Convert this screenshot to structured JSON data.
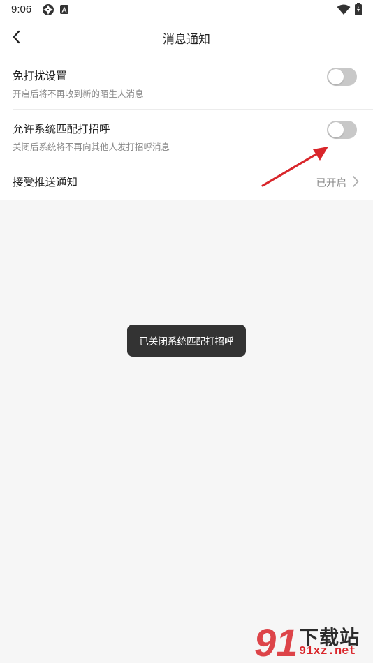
{
  "status_bar": {
    "time": "9:06",
    "icons": [
      "aperture-icon",
      "a-letter-icon",
      "wifi-icon",
      "battery-charging-icon"
    ]
  },
  "header": {
    "title": "消息通知",
    "back_icon": "chevron-left-icon"
  },
  "settings": [
    {
      "title": "免打扰设置",
      "subtitle": "开启后将不再收到新的陌生人消息",
      "toggle_on": false
    },
    {
      "title": "允许系统匹配打招呼",
      "subtitle": "关闭后系统将不再向其他人发打招呼消息",
      "toggle_on": false
    },
    {
      "title": "接受推送通知",
      "value": "已开启",
      "icon": "chevron-right-icon"
    }
  ],
  "toast": {
    "text": "已关闭系统匹配打招呼"
  },
  "colors": {
    "toggle_off": "#c8c8c8",
    "toast_bg": "#333333",
    "annotation_arrow": "#d9262b",
    "background": "#f6f6f6"
  },
  "watermark": {
    "brand": "下载站",
    "domain": "91xz.net",
    "logo_text": "91"
  }
}
